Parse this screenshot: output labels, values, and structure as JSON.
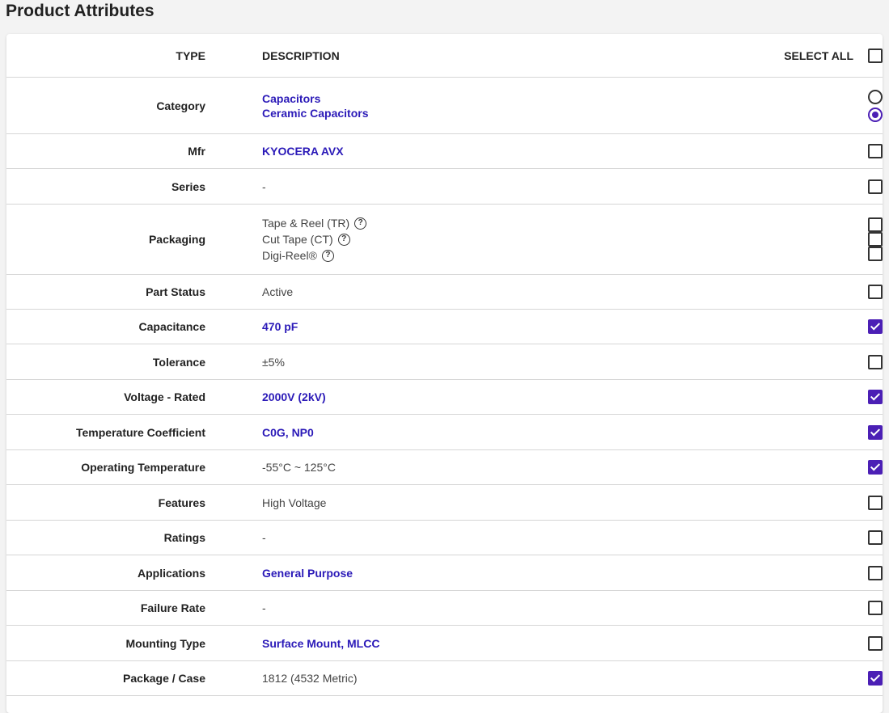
{
  "page": {
    "title": "Product Attributes"
  },
  "header": {
    "type": "TYPE",
    "description": "DESCRIPTION",
    "select_all": "SELECT ALL"
  },
  "rows": [
    {
      "type": "Category",
      "values": [
        "Capacitors",
        "Ceramic Capacitors"
      ],
      "link": true,
      "control": "radio",
      "selected": [
        false,
        true
      ]
    },
    {
      "type": "Mfr",
      "values": [
        "KYOCERA AVX"
      ],
      "link": true,
      "control": "checkbox",
      "checked": false
    },
    {
      "type": "Series",
      "values": [
        "-"
      ],
      "link": false,
      "control": "checkbox",
      "checked": false
    },
    {
      "type": "Packaging",
      "values": [
        "Tape & Reel (TR)",
        "Cut Tape (CT)",
        "Digi-Reel®"
      ],
      "link": false,
      "control": "checkbox-multi",
      "checked": [
        false,
        false,
        false
      ]
    },
    {
      "type": "Part Status",
      "values": [
        "Active"
      ],
      "link": false,
      "control": "checkbox",
      "checked": false
    },
    {
      "type": "Capacitance",
      "values": [
        "470 pF"
      ],
      "link": true,
      "control": "checkbox",
      "checked": true
    },
    {
      "type": "Tolerance",
      "values": [
        "±5%"
      ],
      "link": false,
      "control": "checkbox",
      "checked": false
    },
    {
      "type": "Voltage - Rated",
      "values": [
        "2000V (2kV)"
      ],
      "link": true,
      "control": "checkbox",
      "checked": true
    },
    {
      "type": "Temperature Coefficient",
      "values": [
        "C0G, NP0"
      ],
      "link": true,
      "control": "checkbox",
      "checked": true
    },
    {
      "type": "Operating Temperature",
      "values": [
        "-55°C ~ 125°C"
      ],
      "link": false,
      "control": "checkbox",
      "checked": true
    },
    {
      "type": "Features",
      "values": [
        "High Voltage"
      ],
      "link": false,
      "control": "checkbox",
      "checked": false
    },
    {
      "type": "Ratings",
      "values": [
        "-"
      ],
      "link": false,
      "control": "checkbox",
      "checked": false
    },
    {
      "type": "Applications",
      "values": [
        "General Purpose"
      ],
      "link": true,
      "control": "checkbox",
      "checked": false
    },
    {
      "type": "Failure Rate",
      "values": [
        "-"
      ],
      "link": false,
      "control": "checkbox",
      "checked": false
    },
    {
      "type": "Mounting Type",
      "values": [
        "Surface Mount, MLCC"
      ],
      "link": true,
      "control": "checkbox",
      "checked": false
    },
    {
      "type": "Package / Case",
      "values": [
        "1812 (4532 Metric)"
      ],
      "link": false,
      "control": "checkbox",
      "checked": true
    }
  ],
  "colors": {
    "link": "#2b1ab8",
    "accent": "#4b1fb5"
  },
  "icons": {
    "help": "question-circle-icon"
  }
}
